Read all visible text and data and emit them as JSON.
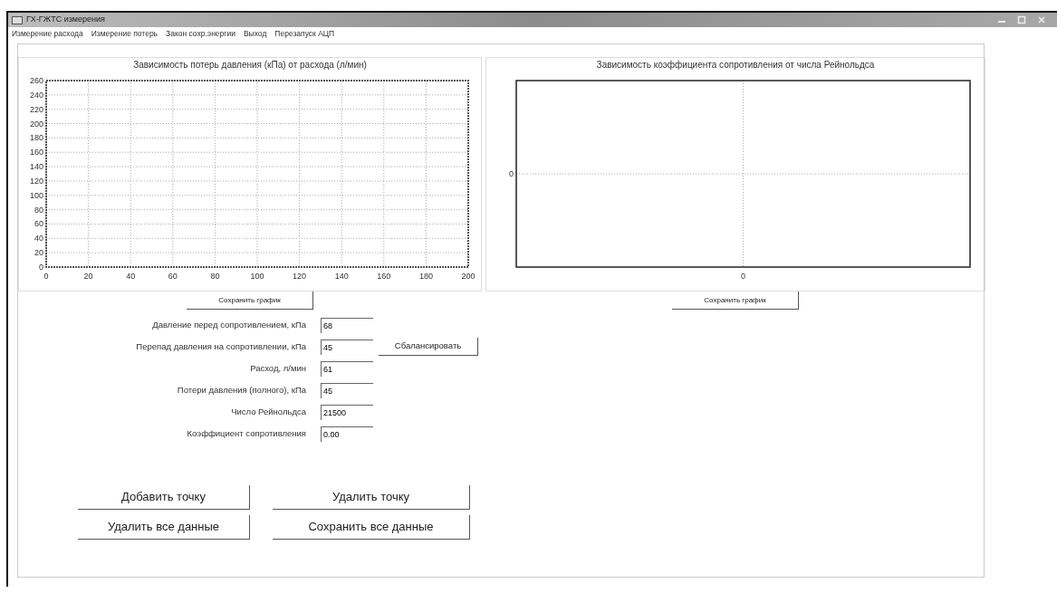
{
  "window": {
    "title": "ГХ-ГЖТС измерения"
  },
  "menu": [
    "Измерение расхода",
    "Измерение потерь",
    "Закон сохр.энергии",
    "Выход",
    "Перезапуск АЦП"
  ],
  "charts": [
    {
      "chart_data": {
        "type": "line",
        "title": "Зависимость потерь давления (кПа) от расхода (л/мин)",
        "xlim": [
          0,
          200
        ],
        "ylim": [
          0,
          260
        ],
        "xticks": [
          0,
          20,
          40,
          60,
          80,
          100,
          120,
          140,
          160,
          180,
          200
        ],
        "yticks": [
          0,
          20,
          40,
          60,
          80,
          100,
          120,
          140,
          160,
          180,
          200,
          220,
          240,
          260
        ],
        "grid": true
      },
      "save_button": "Сохранить график"
    },
    {
      "plot": {
        "title": "Зависимость коэффициента сопротивления от числа Рейнольдса",
        "y_axis_label": "0",
        "x_axis_label": "0"
      },
      "save_button": "Сохранить график"
    }
  ],
  "fields": [
    {
      "label": "Давление перед сопротивлением, кПа",
      "value": "68"
    },
    {
      "label": "Перепад давления на сопротивлении, кПа",
      "value": "45",
      "action": "Сбалансировать"
    },
    {
      "label": "Расход, л/мин",
      "value": "61"
    },
    {
      "label": "Потери давления (полного), кПа",
      "value": "45"
    },
    {
      "label": "Число Рейнольдса",
      "value": "21500"
    },
    {
      "label": "Коэффициент сопротивления",
      "value": "0.00"
    }
  ],
  "buttons": [
    "Добавить точку",
    "Удалить точку",
    "Удалить все данные",
    "Сохранить все данные"
  ]
}
